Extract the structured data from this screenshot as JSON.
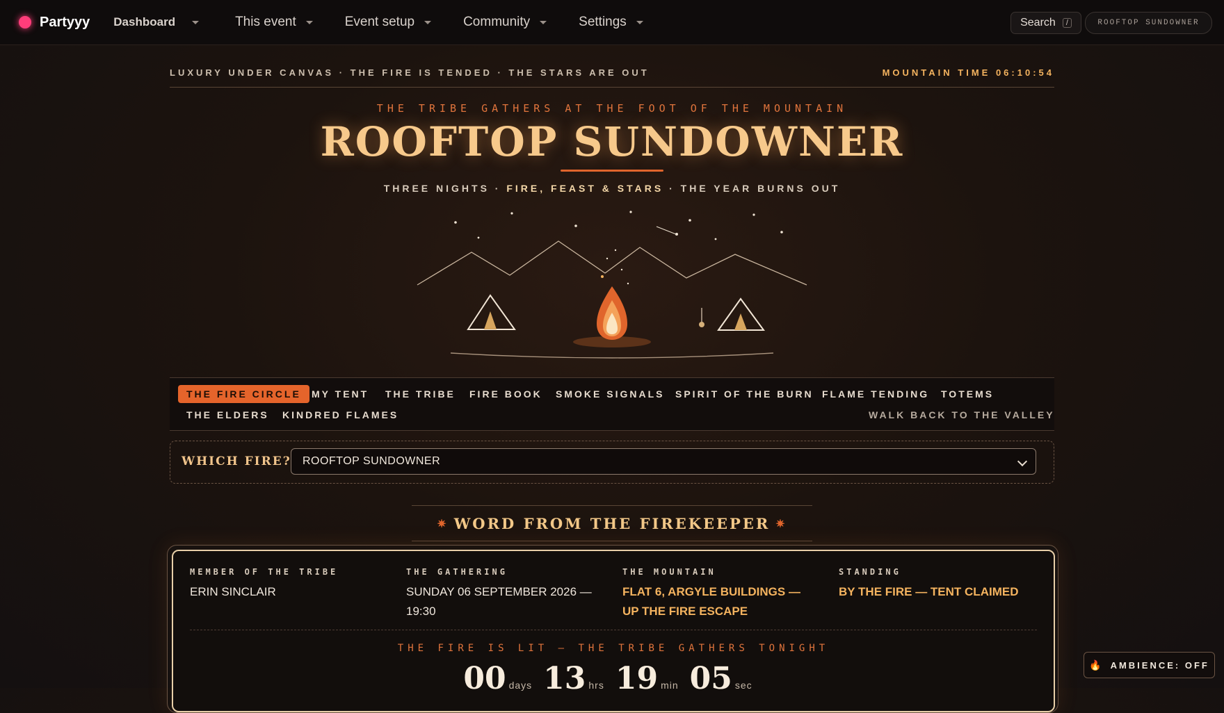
{
  "nav": {
    "brand": "Partyyy",
    "items": [
      "Dashboard",
      "This event",
      "Event setup",
      "Community",
      "Settings"
    ],
    "search_label": "Search",
    "search_key": "/",
    "event_pill": "ROOFTOP SUNDOWNER"
  },
  "header": {
    "tagline": "LUXURY UNDER CANVAS · THE FIRE IS TENDED · THE STARS ARE OUT",
    "clock": "MOUNTAIN TIME 06:10:54",
    "kicker": "THE TRIBE GATHERS AT THE FOOT OF THE MOUNTAIN",
    "title": "ROOFTOP SUNDOWNER",
    "subtitle_a": "THREE NIGHTS ·",
    "subtitle_b": "FIRE, FEAST & STARS",
    "subtitle_c": "· THE YEAR BURNS OUT"
  },
  "tabs": {
    "items": [
      "THE FIRE CIRCLE",
      "MY TENT",
      "THE TRIBE",
      "FIRE BOOK",
      "SMOKE SIGNALS",
      "SPIRIT OF THE BURN",
      "FLAME TENDING",
      "TOTEMS",
      "THE ELDERS",
      "KINDRED FLAMES"
    ],
    "back": "WALK BACK TO THE VALLEY",
    "active_index": 0
  },
  "selector": {
    "label": "WHICH FIRE?",
    "value": "ROOFTOP SUNDOWNER"
  },
  "section": {
    "title": "WORD FROM THE FIREKEEPER"
  },
  "card": {
    "member_label": "MEMBER OF THE TRIBE",
    "member_value": "ERIN SINCLAIR",
    "gathering_label": "THE GATHERING",
    "gathering_value": "SUNDAY 06 SEPTEMBER 2026 — 19:30",
    "mountain_label": "THE MOUNTAIN",
    "mountain_value": "FLAT 6, ARGYLE BUILDINGS — UP THE FIRE ESCAPE",
    "standing_label": "STANDING",
    "standing_value": "BY THE FIRE — TENT CLAIMED",
    "lit_text": "THE FIRE IS LIT — THE TRIBE GATHERS TONIGHT",
    "countdown": {
      "days": "00",
      "days_unit": "days",
      "hrs": "13",
      "hrs_unit": "hrs",
      "min": "19",
      "min_unit": "min",
      "sec": "05",
      "sec_unit": "sec"
    }
  },
  "ambience": {
    "label": "AMBIENCE: OFF"
  },
  "colors": {
    "accent": "#e5642b",
    "gold": "#f4b35f",
    "title": "#f7c98b"
  }
}
